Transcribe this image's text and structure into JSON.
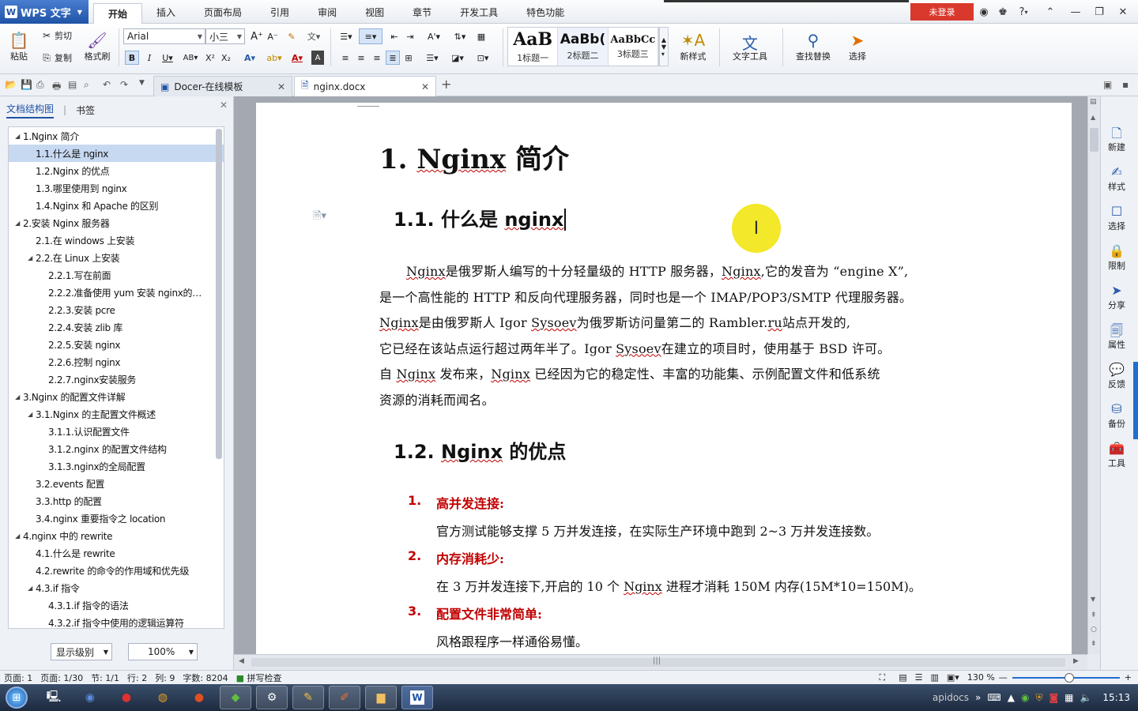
{
  "app": {
    "name": "WPS 文字",
    "login": "未登录",
    "help": "?"
  },
  "menu": [
    "开始",
    "插入",
    "页面布局",
    "引用",
    "审阅",
    "视图",
    "章节",
    "开发工具",
    "特色功能"
  ],
  "ribbon": {
    "paste": "粘贴",
    "cut": "剪切",
    "copy": "复制",
    "format_painter": "格式刷",
    "font_name": "Arial",
    "font_size": "小三",
    "styles": [
      {
        "preview": "AaB",
        "label": "1标题一"
      },
      {
        "preview": "AaBb(",
        "label": "2标题二"
      },
      {
        "preview": "AaBbCc",
        "label": "3标题三"
      }
    ],
    "new_style": "新样式",
    "text_tools": "文字工具",
    "find_replace": "查找替换",
    "select": "选择"
  },
  "tabs": [
    {
      "label": "Docer-在线模板",
      "active": false
    },
    {
      "label": "nginx.docx",
      "active": true
    }
  ],
  "nav": {
    "tab_outline": "文档结构图",
    "tab_bookmark": "书签",
    "items": [
      {
        "label": "1.Nginx 简介",
        "level": 1,
        "expand": "◢",
        "selected": false
      },
      {
        "label": "1.1.什么是 nginx",
        "level": 2,
        "expand": "",
        "selected": true
      },
      {
        "label": "1.2.Nginx 的优点",
        "level": 2,
        "expand": "",
        "selected": false
      },
      {
        "label": "1.3.哪里使用到 nginx",
        "level": 2,
        "expand": "",
        "selected": false
      },
      {
        "label": "1.4.Nginx 和 Apache 的区别",
        "level": 2,
        "expand": "",
        "selected": false
      },
      {
        "label": "2.安装 Nginx 服务器",
        "level": 1,
        "expand": "◢",
        "selected": false
      },
      {
        "label": "2.1.在 windows 上安装",
        "level": 2,
        "expand": "",
        "selected": false
      },
      {
        "label": "2.2.在 Linux 上安装",
        "level": 2,
        "expand": "◢",
        "selected": false
      },
      {
        "label": "2.2.1.写在前面",
        "level": 3,
        "expand": "",
        "selected": false
      },
      {
        "label": "2.2.2.准备使用 yum 安装 nginx的…",
        "level": 3,
        "expand": "",
        "selected": false
      },
      {
        "label": "2.2.3.安装 pcre",
        "level": 3,
        "expand": "",
        "selected": false
      },
      {
        "label": "2.2.4.安装 zlib 库",
        "level": 3,
        "expand": "",
        "selected": false
      },
      {
        "label": "2.2.5.安装 nginx",
        "level": 3,
        "expand": "",
        "selected": false
      },
      {
        "label": "2.2.6.控制 nginx",
        "level": 3,
        "expand": "",
        "selected": false
      },
      {
        "label": "2.2.7.nginx安装服务",
        "level": 3,
        "expand": "",
        "selected": false
      },
      {
        "label": "3.Nginx 的配置文件详解",
        "level": 1,
        "expand": "◢",
        "selected": false
      },
      {
        "label": "3.1.Nginx 的主配置文件概述",
        "level": 2,
        "expand": "◢",
        "selected": false
      },
      {
        "label": "3.1.1.认识配置文件",
        "level": 3,
        "expand": "",
        "selected": false
      },
      {
        "label": "3.1.2.nginx 的配置文件结构",
        "level": 3,
        "expand": "",
        "selected": false
      },
      {
        "label": "3.1.3.nginx的全局配置",
        "level": 3,
        "expand": "",
        "selected": false
      },
      {
        "label": "3.2.events 配置",
        "level": 2,
        "expand": "",
        "selected": false
      },
      {
        "label": "3.3.http 的配置",
        "level": 2,
        "expand": "",
        "selected": false
      },
      {
        "label": "3.4.nginx 重要指令之 location",
        "level": 2,
        "expand": "",
        "selected": false
      },
      {
        "label": "4.nginx 中的 rewrite",
        "level": 1,
        "expand": "◢",
        "selected": false
      },
      {
        "label": "4.1.什么是 rewrite",
        "level": 2,
        "expand": "",
        "selected": false
      },
      {
        "label": "4.2.rewrite 的命令的作用域和优先级",
        "level": 2,
        "expand": "",
        "selected": false
      },
      {
        "label": "4.3.if 指令",
        "level": 2,
        "expand": "◢",
        "selected": false
      },
      {
        "label": "4.3.1.if 指令的语法",
        "level": 3,
        "expand": "",
        "selected": false
      },
      {
        "label": "4.3.2.if 指令中使用的逻辑运算符",
        "level": 3,
        "expand": "",
        "selected": false
      }
    ],
    "level_select": "显示级别",
    "zoom_select": "100%"
  },
  "document": {
    "h1_num": "1.",
    "h1_word": "Nginx",
    "h1_rest": " 简介",
    "h2a_prefix": "1.1. 什么是 ",
    "h2a_word": "nginx",
    "para": [
      {
        "indent": true,
        "segs": [
          [
            "Nginx",
            true
          ],
          [
            "是俄罗斯人编写的十分轻量级的 HTTP 服务器，",
            false
          ],
          [
            "Nginx",
            true
          ],
          [
            ",它的发音为 “engine X”,",
            false
          ]
        ]
      },
      {
        "indent": false,
        "segs": [
          [
            "是一个高性能的 HTTP 和反向代理服务器，同时也是一个 IMAP/POP3/SMTP 代理服务器。",
            false
          ]
        ]
      },
      {
        "indent": false,
        "segs": [
          [
            "Nginx",
            true
          ],
          [
            "是由俄罗斯人 Igor ",
            false
          ],
          [
            "Sysoev",
            true
          ],
          [
            "为俄罗斯访问量第二的 Rambler.",
            false
          ],
          [
            "ru",
            true
          ],
          [
            "站点开发的,",
            false
          ]
        ]
      },
      {
        "indent": false,
        "segs": [
          [
            "它已经在该站点运行超过两年半了。Igor ",
            false
          ],
          [
            "Sysoev",
            true
          ],
          [
            "在建立的项目时，使用基于 BSD 许可。",
            false
          ]
        ]
      },
      {
        "indent": false,
        "segs": [
          [
            "自 ",
            false
          ],
          [
            "Nginx",
            true
          ],
          [
            " 发布来，",
            false
          ],
          [
            "Nginx",
            true
          ],
          [
            " 已经因为它的稳定性、丰富的功能集、示例配置文件和低系统",
            false
          ]
        ]
      },
      {
        "indent": false,
        "segs": [
          [
            "资源的消耗而闻名。",
            false
          ]
        ]
      }
    ],
    "h2b_prefix": "1.2. ",
    "h2b_word": "Nginx",
    "h2b_rest": " 的优点",
    "list": [
      {
        "num": "1.",
        "title": "高并发连接:",
        "segs": [
          [
            "官方测试能够支撑 5 万并发连接，在实际生产环境中跑到 2~3 万并发连接数。",
            false
          ]
        ]
      },
      {
        "num": "2.",
        "title": "内存消耗少:",
        "segs": [
          [
            "在 3 万并发连接下,开启的 10 个 ",
            false
          ],
          [
            "Nginx",
            true
          ],
          [
            " 进程才消耗 150M 内存(15M*10=150M)。",
            false
          ]
        ]
      },
      {
        "num": "3.",
        "title": "配置文件非常简单:",
        "segs": [
          [
            "风格跟程序一样通俗易懂。",
            false
          ]
        ]
      }
    ]
  },
  "right_tools": [
    "新建",
    "样式",
    "选择",
    "限制",
    "分享",
    "属性",
    "反馈",
    "备份",
    "工具"
  ],
  "status": {
    "page_label": "页面: 1",
    "pages": "页面: 1/30",
    "section": "节: 1/1",
    "row": "行: 2",
    "col": "列: 9",
    "words": "字数: 8204",
    "spell": "拼写检查",
    "zoom": "130 %"
  },
  "taskbar": {
    "tray_text": "apidocs",
    "time": "15:13"
  }
}
